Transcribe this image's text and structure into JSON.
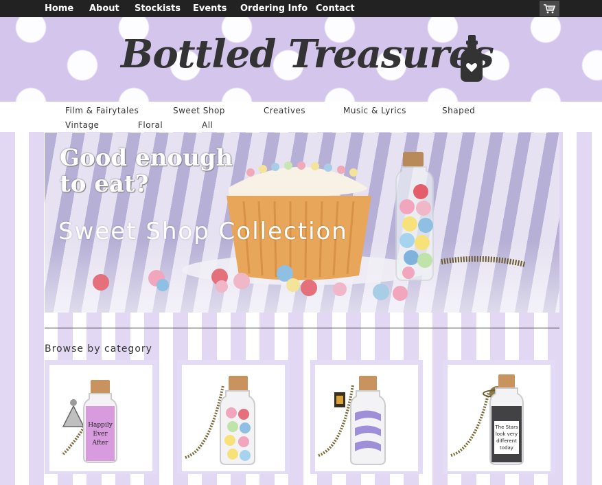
{
  "top_nav": {
    "items": [
      {
        "label": "Home"
      },
      {
        "label": "About"
      },
      {
        "label": "Stockists"
      },
      {
        "label": "Events"
      },
      {
        "label": "Ordering Info"
      },
      {
        "label": "Contact"
      }
    ],
    "cart_icon": "shopping-cart-icon"
  },
  "header": {
    "logo_text": "Bottled Treasures",
    "logo_icon": "bottle-heart-icon"
  },
  "category_nav": {
    "items": [
      {
        "label": "Film & Fairytales"
      },
      {
        "label": "Sweet Shop"
      },
      {
        "label": "Creatives"
      },
      {
        "label": "Music & Lyrics"
      },
      {
        "label": "Shaped"
      },
      {
        "label": "Vintage"
      },
      {
        "label": "Floral"
      },
      {
        "label": "All"
      }
    ]
  },
  "hero": {
    "title": "Good enough\nto eat?",
    "subtitle": "Sweet Shop Collection"
  },
  "browse": {
    "heading": "Browse by category"
  },
  "categories": [
    {
      "bottle_label": [
        "Happily",
        "Ever",
        "After"
      ]
    },
    {
      "bottle_label": []
    },
    {
      "bottle_label": []
    },
    {
      "bottle_label": [
        "The Stars",
        "look very",
        "different",
        "today"
      ]
    }
  ],
  "colors": {
    "topnav_bg": "#222222",
    "stripe_lavender": "#e2d8f3",
    "header_lavender": "#d3c5ec",
    "text_dark": "#333333"
  }
}
